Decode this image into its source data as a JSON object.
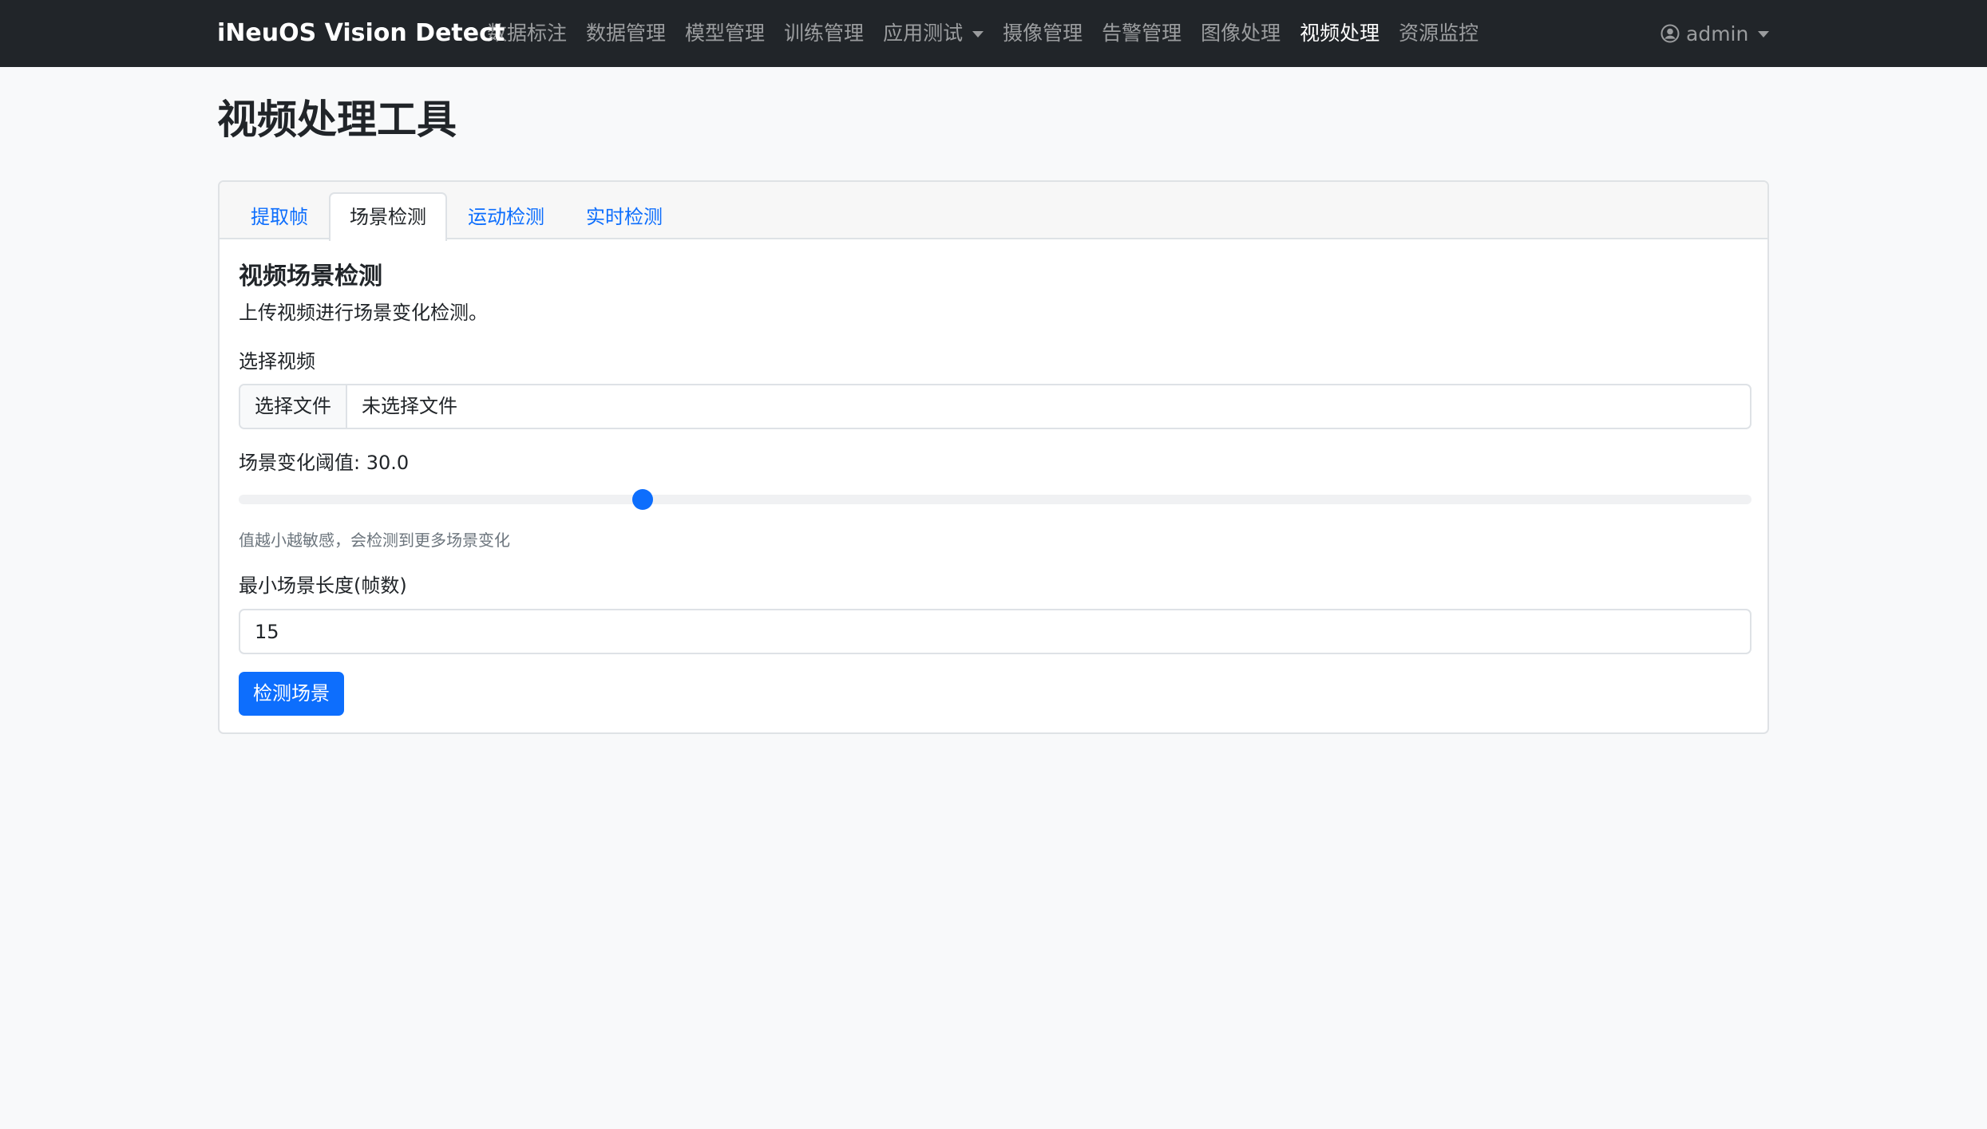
{
  "navbar": {
    "brand": "iNeuOS Vision Detect",
    "items": [
      {
        "label": "数据标注",
        "active": false
      },
      {
        "label": "数据管理",
        "active": false
      },
      {
        "label": "模型管理",
        "active": false
      },
      {
        "label": "训练管理",
        "active": false
      },
      {
        "label": "应用测试",
        "active": false,
        "dropdown": true
      },
      {
        "label": "摄像管理",
        "active": false
      },
      {
        "label": "告警管理",
        "active": false
      },
      {
        "label": "图像处理",
        "active": false
      },
      {
        "label": "视频处理",
        "active": true
      },
      {
        "label": "资源监控",
        "active": false
      }
    ],
    "user": {
      "name": "admin",
      "icon": "user-circle-icon"
    }
  },
  "page": {
    "title": "视频处理工具"
  },
  "tabs": [
    {
      "label": "提取帧",
      "active": false
    },
    {
      "label": "场景检测",
      "active": true
    },
    {
      "label": "运动检测",
      "active": false
    },
    {
      "label": "实时检测",
      "active": false
    }
  ],
  "scene_detect": {
    "title": "视频场景检测",
    "description": "上传视频进行场景变化检测。",
    "video_label": "选择视频",
    "file_button": "选择文件",
    "file_status": "未选择文件",
    "threshold_label": "场景变化阈值: 30.0",
    "threshold_value": 30.0,
    "threshold_fraction": 0.267,
    "threshold_help": "值越小越敏感，会检测到更多场景变化",
    "min_length_label": "最小场景长度(帧数)",
    "min_length_value": "15",
    "submit_label": "检测场景"
  },
  "colors": {
    "navbar_bg": "#212529",
    "primary": "#0d6efd",
    "page_bg": "#f8f9fa",
    "muted": "#6c757d"
  }
}
